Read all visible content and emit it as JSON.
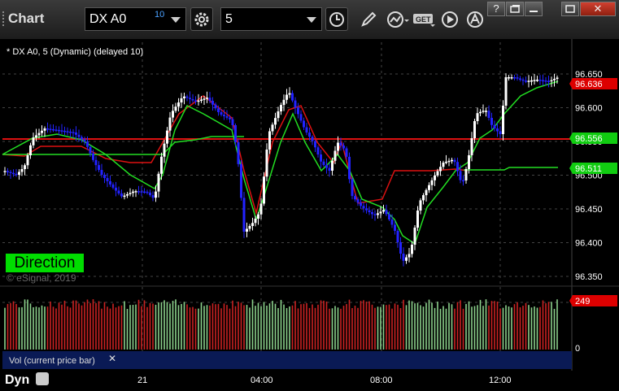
{
  "toolbar": {
    "title": "Chart",
    "symbol": "DX A0",
    "symbol_badge": "10",
    "interval": "5"
  },
  "window_buttons": [
    "?",
    "",
    "",
    "✕"
  ],
  "chart": {
    "label": "* DX A0, 5 (Dynamic) (delayed 10)",
    "direction_label": "Direction",
    "copyright": "© eSignal, 2019",
    "price_ticks": [
      "96.650",
      "96.600",
      "96.550",
      "96.500",
      "96.450",
      "96.400",
      "96.350"
    ],
    "last_price": "96.636",
    "green_level_1": "96.556",
    "green_level_2": "96.511",
    "colors": {
      "bg": "#000000",
      "up_bar": "#ffffff",
      "down_bar": "#2222ff",
      "red_line": "#dd1111",
      "green_line": "#22dd22",
      "label_red": "#dd0000",
      "label_green": "#11cc11"
    }
  },
  "volume": {
    "label": "Vol (current price bar)",
    "last_value": "249",
    "zero_tick": "0",
    "close_symbol": "✕"
  },
  "bottom": {
    "panel_label": "Dyn",
    "x_ticks": [
      "21",
      "04:00",
      "08:00",
      "12:00"
    ]
  }
}
